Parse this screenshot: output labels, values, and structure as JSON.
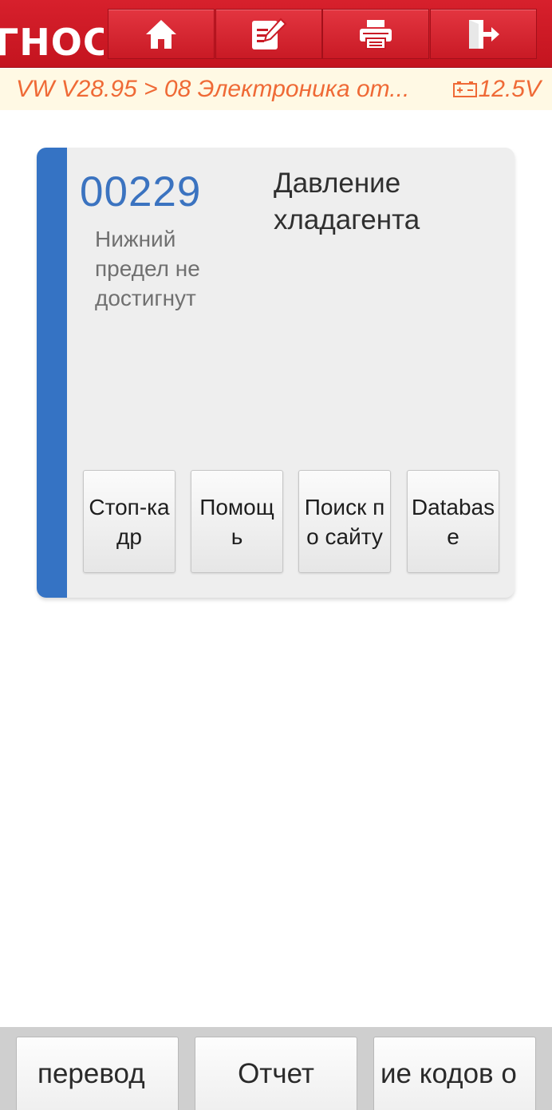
{
  "header": {
    "app_title": "ГНОСТИКА",
    "buttons": [
      {
        "name": "home-button",
        "icon": "home-icon"
      },
      {
        "name": "notes-button",
        "icon": "edit-note-icon"
      },
      {
        "name": "print-button",
        "icon": "printer-icon"
      },
      {
        "name": "exit-button",
        "icon": "exit-icon"
      }
    ]
  },
  "breadcrumb": {
    "path": "VW V28.95 > 08 Электроника от...",
    "voltage": "12.5V",
    "voltage_icon": "battery-icon"
  },
  "dtc": {
    "code": "00229",
    "status": "Нижний предел не достигнут",
    "description": "Давление хладагента",
    "buttons": [
      "Стоп-кадр",
      "Помощь",
      "Поиск по сайту",
      "Database"
    ]
  },
  "footer": {
    "buttons": [
      "перевод",
      "Отчет",
      "ие кодов о"
    ]
  },
  "colors": {
    "header_red": "#d7202c",
    "breadcrumb_orange": "#ef6a36",
    "dtc_blue": "#3b73c0",
    "card_stripe": "#3573c4"
  }
}
